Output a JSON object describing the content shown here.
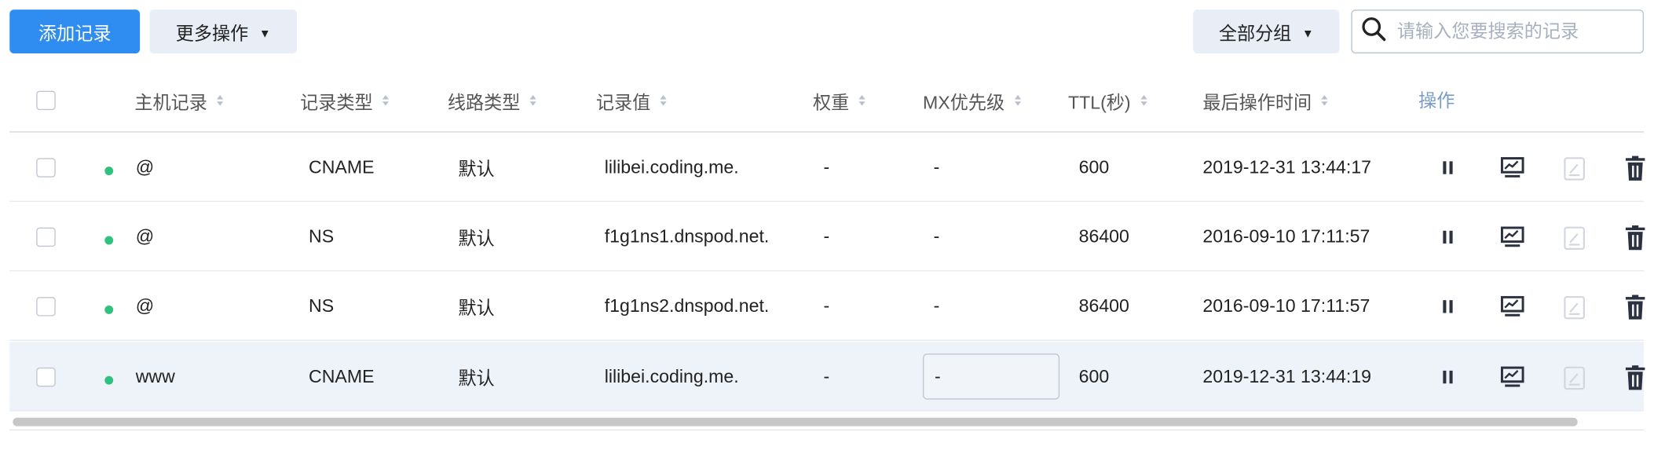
{
  "toolbar": {
    "add_label": "添加记录",
    "more_label": "更多操作",
    "group_label": "全部分组",
    "search_placeholder": "请输入您要搜索的记录"
  },
  "columns": {
    "host": "主机记录",
    "type": "记录类型",
    "line": "线路类型",
    "value": "记录值",
    "weight": "权重",
    "mx": "MX优先级",
    "ttl": "TTL(秒)",
    "time": "最后操作时间",
    "action": "操作"
  },
  "rows": [
    {
      "host": "@",
      "type": "CNAME",
      "line": "默认",
      "value": "lilibei.coding.me.",
      "weight": "-",
      "mx": "-",
      "ttl": "600",
      "time": "2019-12-31 13:44:17",
      "status": "enabled"
    },
    {
      "host": "@",
      "type": "NS",
      "line": "默认",
      "value": "f1g1ns1.dnspod.net.",
      "weight": "-",
      "mx": "-",
      "ttl": "86400",
      "time": "2016-09-10 17:11:57",
      "status": "enabled"
    },
    {
      "host": "@",
      "type": "NS",
      "line": "默认",
      "value": "f1g1ns2.dnspod.net.",
      "weight": "-",
      "mx": "-",
      "ttl": "86400",
      "time": "2016-09-10 17:11:57",
      "status": "enabled"
    },
    {
      "host": "www",
      "type": "CNAME",
      "line": "默认",
      "value": "lilibei.coding.me.",
      "weight": "-",
      "mx": "-",
      "ttl": "600",
      "time": "2019-12-31 13:44:19",
      "status": "enabled"
    }
  ],
  "icons": {
    "pause": "pause-icon",
    "remark": "remark-icon",
    "edit": "edit-icon",
    "delete": "delete-icon",
    "search": "search-icon",
    "caret": "caret-down-icon"
  },
  "colors": {
    "primary": "#2f8cf0",
    "status_ok": "#2ec27e",
    "row_highlight": "#eef2f9"
  }
}
